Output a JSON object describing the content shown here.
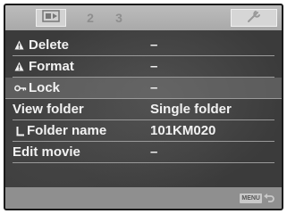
{
  "tabs": [
    {
      "name": "playback",
      "icon": "playback-icon"
    },
    {
      "name": "2",
      "label": "2"
    },
    {
      "name": "3",
      "label": "3"
    },
    {
      "name": "setup",
      "icon": "wrench-icon"
    }
  ],
  "menu": {
    "items": [
      {
        "icon": "warning-icon",
        "label": "Delete",
        "value": "–"
      },
      {
        "icon": "warning-icon",
        "label": "Format",
        "value": "–"
      },
      {
        "icon": "key-icon",
        "label": "Lock",
        "value": "–",
        "selected": true
      },
      {
        "label": "View folder",
        "value": "Single folder"
      },
      {
        "label": "Folder name",
        "value": "101KM020",
        "sub_item": true
      },
      {
        "label": "Edit movie",
        "value": "–"
      }
    ]
  },
  "footer": {
    "back_label": "MENU",
    "back_icon": "return-arrow-icon"
  },
  "colors": {
    "tab_bar": "#b3b3b3",
    "menu_text": "#f2f2f2",
    "background": "#3b3b3b",
    "selected_row": "#6e6e6e",
    "footer": "#8f8f8f"
  }
}
